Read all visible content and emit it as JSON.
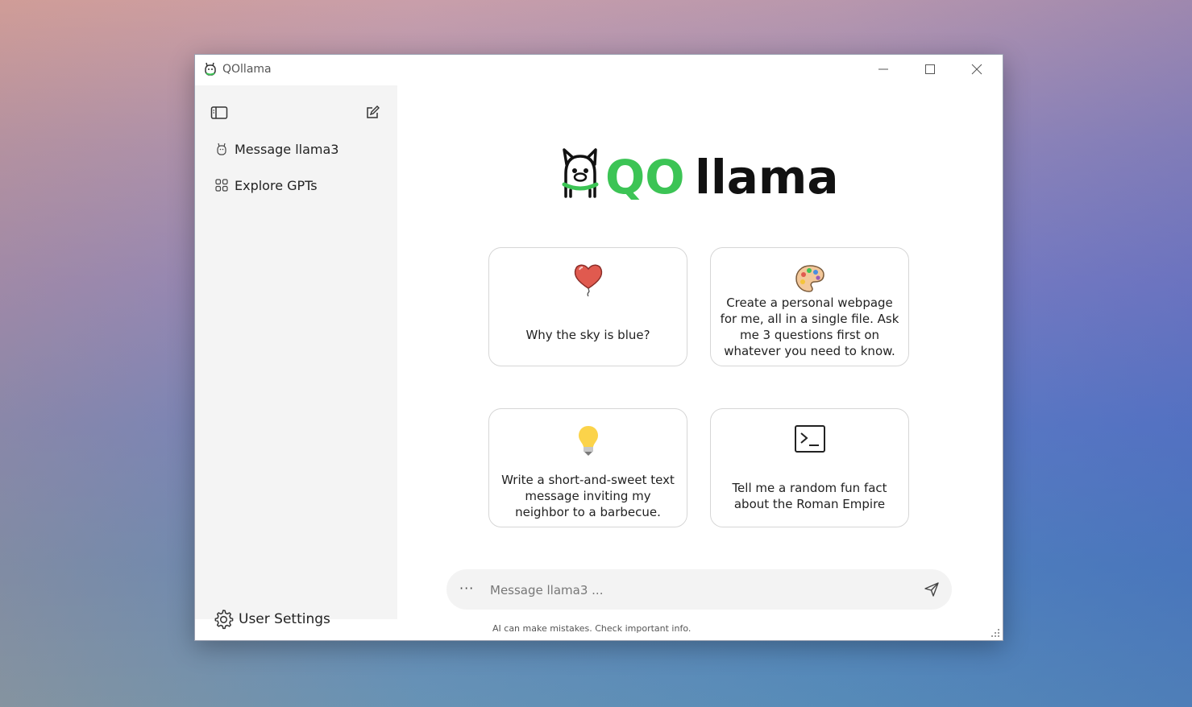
{
  "window": {
    "title": "QOllama",
    "minimize_label": "Minimize",
    "maximize_label": "Maximize",
    "close_label": "Close"
  },
  "sidebar": {
    "toggle_icon": "sidebar-toggle-icon",
    "new_chat_icon": "new-chat-icon",
    "items": [
      {
        "label": "Message llama3",
        "icon": "llama-icon"
      },
      {
        "label": "Explore GPTs",
        "icon": "grid-icon"
      }
    ],
    "settings_label": "User Settings"
  },
  "logo": {
    "text_q": "QO",
    "text_rest": "llama",
    "accent": "#3cc455"
  },
  "cards": [
    {
      "text": "Why the sky is blue?",
      "icon": "heart-balloon-icon"
    },
    {
      "text": "Create a personal webpage for me, all in a single file. Ask me 3 questions first on whatever you need to know.",
      "icon": "palette-icon"
    },
    {
      "text": "Write a short-and-sweet text message inviting my neighbor to a barbecue.",
      "icon": "lightbulb-icon"
    },
    {
      "text": "Tell me a random fun fact about the Roman Empire",
      "icon": "terminal-icon"
    }
  ],
  "composer": {
    "more_label": "···",
    "placeholder": "Message llama3 ...",
    "value": ""
  },
  "disclaimer": "AI can make mistakes. Check important info."
}
